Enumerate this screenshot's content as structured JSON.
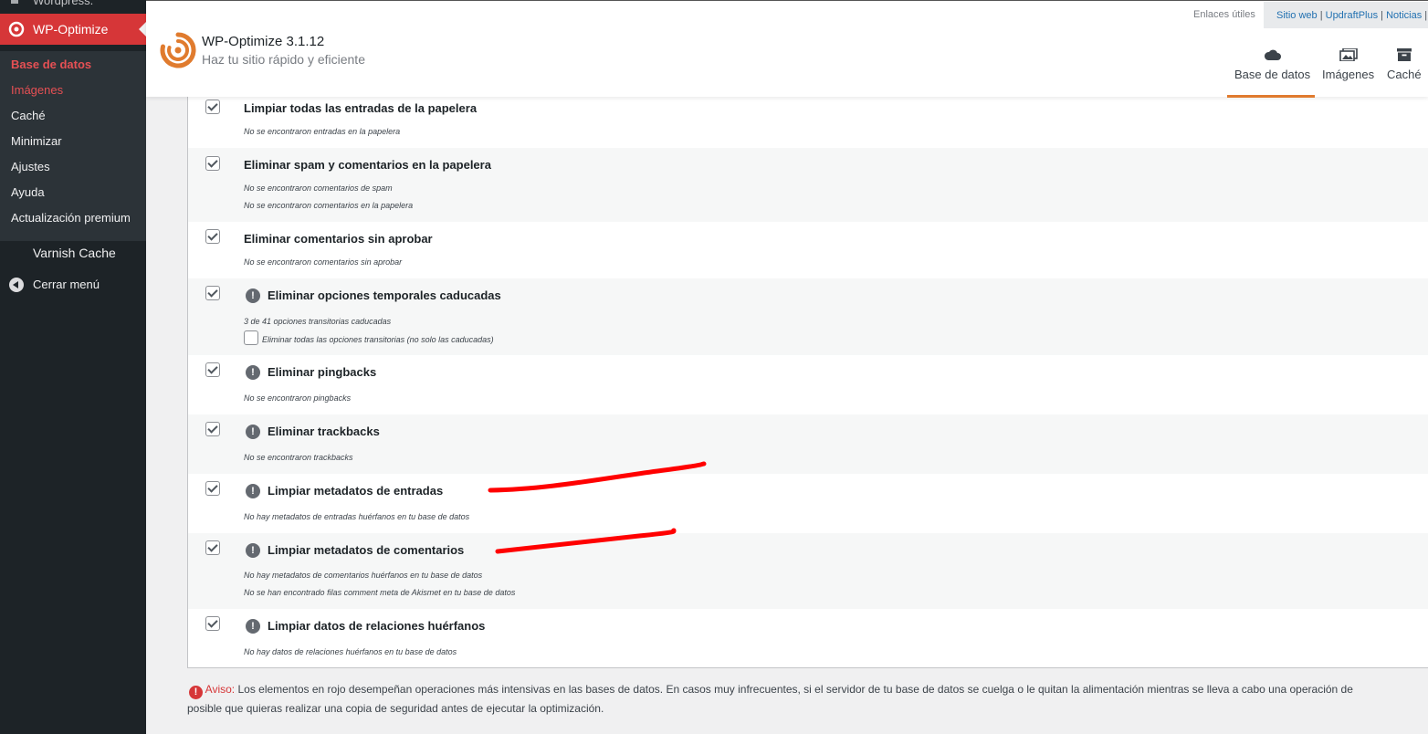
{
  "sidebar": {
    "top_partial": "Wordpress.",
    "active_item": "WP-Optimize",
    "submenu": [
      {
        "label": "Base de datos",
        "state": "current"
      },
      {
        "label": "Imágenes",
        "state": "highlight"
      },
      {
        "label": "Caché",
        "state": "normal"
      },
      {
        "label": "Minimizar",
        "state": "normal"
      },
      {
        "label": "Ajustes",
        "state": "normal"
      },
      {
        "label": "Ayuda",
        "state": "normal"
      },
      {
        "label": "Actualización premium",
        "state": "normal"
      }
    ],
    "varnish": "Varnish Cache",
    "collapse": "Cerrar menú"
  },
  "header": {
    "title": "WP-Optimize 3.1.12",
    "tagline": "Haz tu sitio rápido y eficiente",
    "useful_links_label": "Enlaces útiles",
    "links": [
      "Sitio web",
      "UpdraftPlus",
      "Noticias"
    ],
    "link_separator": "|",
    "tabs": [
      {
        "label": "Base de datos",
        "icon": "cloud-icon",
        "active": true
      },
      {
        "label": "Imágenes",
        "icon": "images-icon",
        "active": false
      },
      {
        "label": "Caché",
        "icon": "archive-icon",
        "active": false
      }
    ]
  },
  "optimizations": [
    {
      "title": "Limpiar todas las entradas de la papelera",
      "warning": false,
      "checked": true,
      "details": [
        "No se encontraron entradas en la papelera"
      ]
    },
    {
      "title": "Eliminar spam y comentarios en la papelera",
      "warning": false,
      "checked": true,
      "details": [
        "No se encontraron comentarios de spam",
        "No se encontraron comentarios en la papelera"
      ]
    },
    {
      "title": "Eliminar comentarios sin aprobar",
      "warning": false,
      "checked": true,
      "details": [
        "No se encontraron comentarios sin aprobar"
      ]
    },
    {
      "title": "Eliminar opciones temporales caducadas",
      "warning": true,
      "checked": true,
      "details": [
        "3 de 41 opciones transitorias caducadas"
      ],
      "sub_option": {
        "label": "Eliminar todas las opciones transitorias (no solo las caducadas)",
        "checked": false
      }
    },
    {
      "title": "Eliminar pingbacks",
      "warning": true,
      "checked": true,
      "details": [
        "No se encontraron pingbacks"
      ]
    },
    {
      "title": "Eliminar trackbacks",
      "warning": true,
      "checked": true,
      "details": [
        "No se encontraron trackbacks"
      ]
    },
    {
      "title": "Limpiar metadatos de entradas",
      "warning": true,
      "checked": true,
      "details": [
        "No hay metadatos de entradas huérfanos en tu base de datos"
      ]
    },
    {
      "title": "Limpiar metadatos de comentarios",
      "warning": true,
      "checked": true,
      "details": [
        "No hay metadatos de comentarios huérfanos en tu base de datos",
        "No se han encontrado filas comment meta de Akismet en tu base de datos"
      ]
    },
    {
      "title": "Limpiar datos de relaciones huérfanos",
      "warning": true,
      "checked": true,
      "details": [
        "No hay datos de relaciones huérfanos en tu base de datos"
      ]
    }
  ],
  "notice": {
    "label": "Aviso:",
    "line1": "Los elementos en rojo desempeñan operaciones más intensivas en las bases de datos. En casos muy infrecuentes, si el servidor de tu base de datos se cuelga o le quitan la alimentación mientras se lleva a cabo una operación de",
    "line2": "posible que quieras realizar una copia de seguridad antes de ejecutar la optimización."
  },
  "colors": {
    "sidebar_bg": "#1d2327",
    "active_red": "#d63638",
    "accent_orange": "#e07b2e",
    "annotation_red": "#ff0000"
  }
}
